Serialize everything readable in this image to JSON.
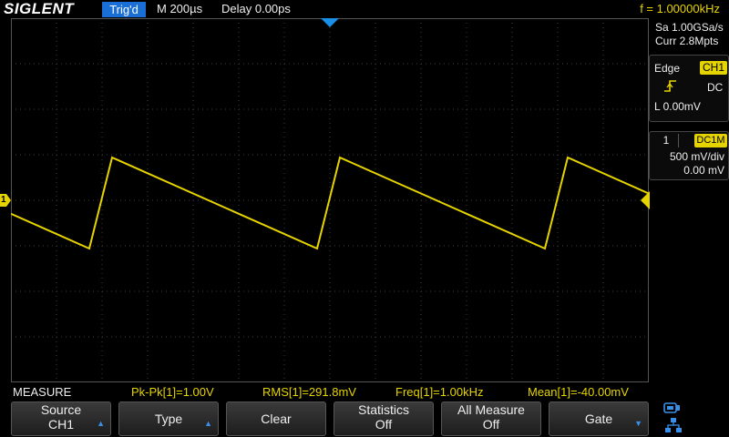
{
  "header": {
    "brand": "SIGLENT",
    "trigger_status": "Trig'd",
    "timebase": "M 200µs",
    "delay": "Delay 0.00ps",
    "frequency": "f = 1.00000kHz"
  },
  "acquisition": {
    "sample_rate": "Sa 1.00GSa/s",
    "memory_depth": "Curr 2.8Mpts"
  },
  "trigger": {
    "type": "Edge",
    "source": "CH1",
    "coupling": "DC",
    "level": "L  0.00mV",
    "slope_icon": "rising-edge-icon"
  },
  "channel": {
    "number": "1",
    "coupling": "DC1M",
    "scale": "500 mV/div",
    "offset": "0.00 mV",
    "marker_label": "1",
    "color": "#e6d400"
  },
  "measure": {
    "title": "MEASURE",
    "pkpk": "Pk-Pk[1]=1.00V",
    "rms": "RMS[1]=291.8mV",
    "freq": "Freq[1]=1.00kHz",
    "mean": "Mean[1]=-40.00mV"
  },
  "softkeys": {
    "source": {
      "line1": "Source",
      "line2": "CH1"
    },
    "type": {
      "label": "Type"
    },
    "clear": {
      "label": "Clear"
    },
    "statistics": {
      "line1": "Statistics",
      "line2": "Off"
    },
    "all_measure": {
      "line1": "All Measure",
      "line2": "Off"
    },
    "gate": {
      "label": "Gate"
    }
  },
  "colors": {
    "accent_blue": "#1a6fd6",
    "trace_yellow": "#e6d400",
    "grid": "#3c3c3c"
  },
  "waveform": {
    "type": "sawtooth",
    "frequency_hz": 1000,
    "peak_to_peak_v": 1.0,
    "volts_per_div": 0.5,
    "time_per_div_s": 0.0002
  }
}
